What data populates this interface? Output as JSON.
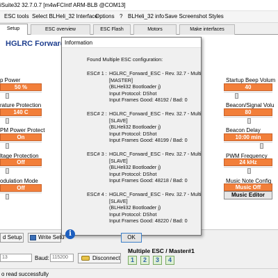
{
  "window": {
    "title": "iSuite32 32.7.0.7  [m4wFCIntf ARM-BLB @COM13]"
  },
  "menu": [
    "ESC tools",
    "Select BLHeli_32 Interface",
    "Options",
    "?",
    "BLHeli_32 info",
    "Save Screenshot",
    "Styles"
  ],
  "tabs": [
    "Setup",
    "ESC overview",
    "ESC Flash",
    "Motors",
    "Make interfaces"
  ],
  "esc_name": "HGLRC Forward",
  "left_params": [
    {
      "label": "p Power",
      "value": "50 %"
    },
    {
      "label": "rature Protection",
      "value": "140 C"
    },
    {
      "label": "PM Power Protect",
      "value": "On"
    },
    {
      "label": "ltage Protection",
      "value": "Off"
    },
    {
      "label": "odulation Mode",
      "value": "Off"
    }
  ],
  "right_params": [
    {
      "label": "Startup Beep Volum",
      "value": "40"
    },
    {
      "label": "Beacon/Signal Volu",
      "value": "80"
    },
    {
      "label": "Beacon Delay",
      "value": "10:00 min"
    },
    {
      "label": "PWM Frequency",
      "value": "24 kHz"
    },
    {
      "label": "Music Note Config",
      "value": "Music Off"
    }
  ],
  "music_editor_label": "Music Editor",
  "bottom": {
    "read_setup_label": "d Setup",
    "write_setup_label": "Write Setu",
    "port_value": "13",
    "baud_label": "Baud:",
    "baud_value": "115200",
    "disconnect_label": "Disconnect",
    "multi_esc_label": "Multiple ESC / Master#1",
    "esc_buttons": [
      "1",
      "2",
      "3",
      "4"
    ]
  },
  "status_text": "o read successfully",
  "dialog": {
    "title": "Information",
    "heading": "Found Multiple ESC configuration:",
    "escs": [
      {
        "label": "ESC# 1 :",
        "lines": [
          "HGLRC_Forward_ESC - Rev. 32.7 - Multi",
          "[MASTER]",
          "(BLHeli32 Bootloader j)",
          "Input Protocol: DShot",
          "Input Frames Good: 48192 / Bad: 0"
        ]
      },
      {
        "label": "ESC# 2 :",
        "lines": [
          "HGLRC_Forward_ESC - Rev. 32.7 - Multi",
          "[SLAVE]",
          "(BLHeli32 Bootloader j)",
          "Input Protocol: DShot",
          "Input Frames Good: 48199 / Bad: 0"
        ]
      },
      {
        "label": "ESC# 3 :",
        "lines": [
          "HGLRC_Forward_ESC - Rev. 32.7 - Multi",
          "[SLAVE]",
          "(BLHeli32 Bootloader j)",
          "Input Protocol: DShot",
          "Input Frames Good: 48218 / Bad: 0"
        ]
      },
      {
        "label": "ESC# 4 :",
        "lines": [
          "HGLRC_Forward_ESC - Rev. 32.7 - Multi",
          "[SLAVE]",
          "(BLHeli32 Bootloader j)",
          "Input Protocol: DShot",
          "Input Frames Good: 48220 / Bad: 0"
        ]
      }
    ],
    "ok_label": "OK"
  },
  "colors": {
    "param_value_bg": "#f27f3a",
    "title_blue": "#1f3f8f",
    "info_icon": "#1d5fbf"
  }
}
